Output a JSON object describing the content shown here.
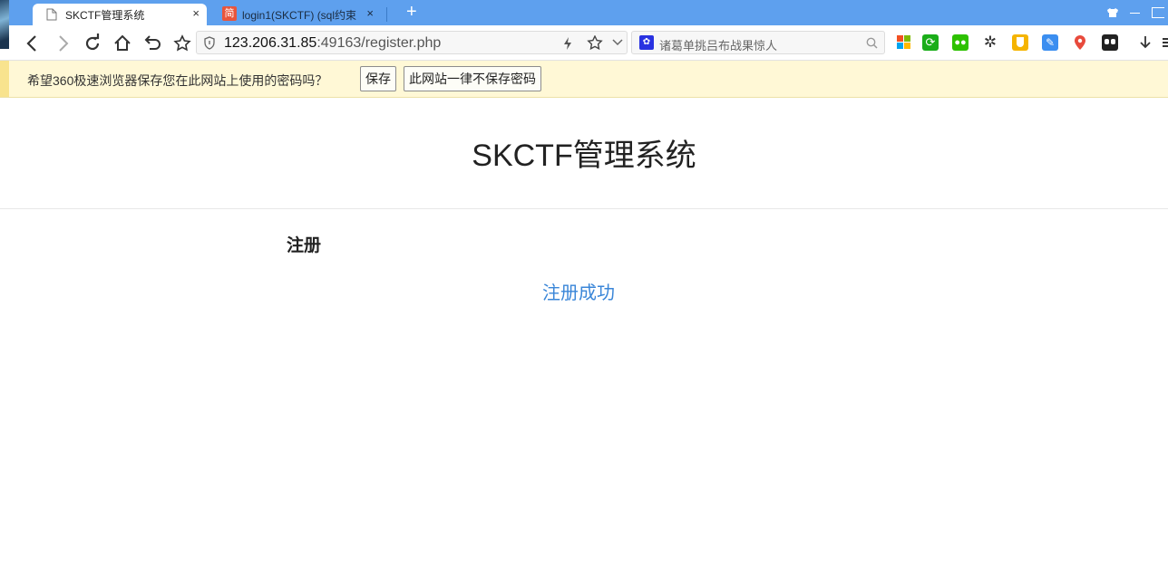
{
  "tabs": [
    {
      "title": "SKCTF管理系统",
      "close": "×",
      "favicon": "page-icon"
    },
    {
      "title": "login1(SKCTF) (sql约束",
      "close": "×",
      "favicon": "jianshu-icon",
      "favicon_text": "简"
    }
  ],
  "new_tab": "+",
  "address": {
    "host": "123.206.31.85",
    "path": ":49163/register.php"
  },
  "search": {
    "placeholder": "诸葛单挑吕布战果惊人"
  },
  "password_bar": {
    "message": "希望360极速浏览器保存您在此网站上使用的密码吗？",
    "save_label": "保存",
    "never_label": "此网站一律不保存密码"
  },
  "page": {
    "title": "SKCTF管理系统",
    "section": "注册",
    "message": "注册成功"
  },
  "colors": {
    "tabbar": "#5ea0ee",
    "link": "#3a86d8",
    "infobar": "#fff8d6"
  }
}
